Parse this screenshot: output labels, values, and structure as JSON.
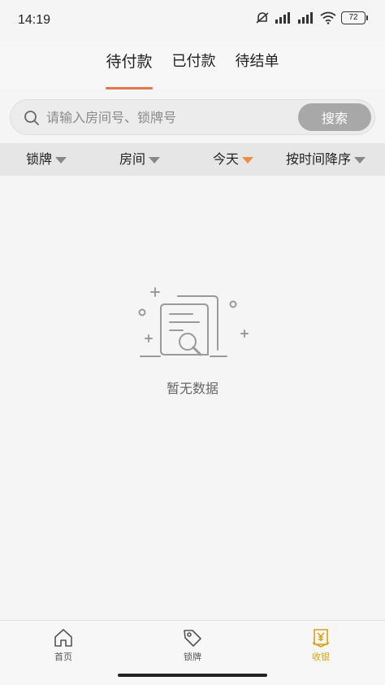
{
  "status_bar": {
    "time": "14:19",
    "battery": "72"
  },
  "tabs": [
    {
      "label": "待付款",
      "active": true
    },
    {
      "label": "已付款",
      "active": false
    },
    {
      "label": "待结单",
      "active": false
    }
  ],
  "search": {
    "placeholder": "请输入房间号、锁牌号",
    "button_label": "搜索"
  },
  "filters": [
    {
      "label": "锁牌",
      "active": false
    },
    {
      "label": "房间",
      "active": false
    },
    {
      "label": "今天",
      "active": true
    },
    {
      "label": "按时间降序",
      "active": false
    }
  ],
  "empty_state": {
    "text": "暂无数据",
    "icon": "empty-document-search-icon"
  },
  "bottom_nav": [
    {
      "label": "首页",
      "icon": "home-icon",
      "active": false
    },
    {
      "label": "锁牌",
      "icon": "tag-icon",
      "active": false
    },
    {
      "label": "收银",
      "icon": "cashier-yen-icon",
      "active": true
    }
  ],
  "colors": {
    "accent": "#e8744a",
    "active_caret": "#f08a45",
    "nav_active": "#d9a214",
    "background": "#f5f5f5"
  }
}
